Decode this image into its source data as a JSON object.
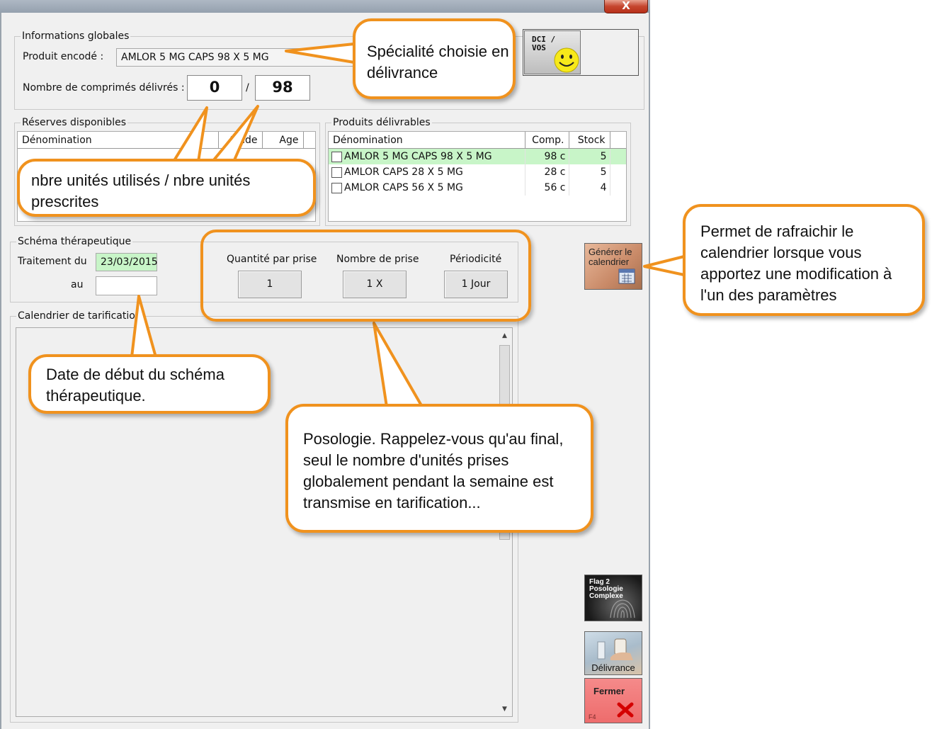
{
  "window": {
    "close_label": "X"
  },
  "info": {
    "legend": "Informations globales",
    "product_label": "Produit encodé :",
    "product_value": "AMLOR 5 MG CAPS 98 X 5 MG",
    "count_label": "Nombre de comprimés délivrés :",
    "delivered_value": "0",
    "separator": "/",
    "prescribed_value": "98"
  },
  "dci_button": {
    "label_line1": "DCI /",
    "label_line2": "VOS"
  },
  "reserves": {
    "legend": "Réserves disponibles",
    "columns": [
      "Dénomination",
      "Solde",
      "Age"
    ]
  },
  "products": {
    "legend": "Produits délivrables",
    "columns": [
      "Dénomination",
      "Comp.",
      "Stock"
    ],
    "rows": [
      {
        "name": "AMLOR 5 MG CAPS 98 X 5 MG",
        "comp": "98 c",
        "stock": "5"
      },
      {
        "name": "AMLOR CAPS 28 X 5 MG",
        "comp": "28 c",
        "stock": "5"
      },
      {
        "name": "AMLOR CAPS 56 X 5 MG",
        "comp": "56 c",
        "stock": "4"
      }
    ]
  },
  "schema": {
    "legend": "Schéma thérapeutique",
    "from_label": "Traitement du",
    "from_value": "23/03/2015",
    "to_label": "au",
    "to_value": "",
    "qty_label": "Quantité par prise",
    "qty_value": "1",
    "count_label": "Nombre de prise",
    "count_value": "1 X",
    "period_label": "Périodicité",
    "period_value": "1 Jour"
  },
  "calendar": {
    "legend": "Calendrier de tarification",
    "scroll_up": "▲",
    "scroll_down": "▼"
  },
  "side_buttons": {
    "generate_line1": "Générer le",
    "generate_line2": "calendrier",
    "flag_line1": "Flag 2",
    "flag_line2": "Posologie",
    "flag_line3": "Complexe",
    "delivery": "Délivrance",
    "close": "Fermer",
    "close_key": "F4"
  },
  "callouts": {
    "speciality": "Spécialité choisie en délivrance",
    "units": "nbre unités utilisés / nbre unités prescrites",
    "refresh": "Permet de rafraichir le calendrier lorsque vous apportez une modification à l'un des paramètres",
    "start_date": "Date de début du schéma thérapeutique.",
    "posology": "Posologie. Rappelez-vous qu'au final, seul le nombre d'unités prises globalement pendant la semaine est transmise en tarification..."
  },
  "colors": {
    "callout_border": "#f0921e",
    "selected_row": "#c8f5c8",
    "date_field": "#c8f5c8",
    "close_button": "#f07070"
  }
}
